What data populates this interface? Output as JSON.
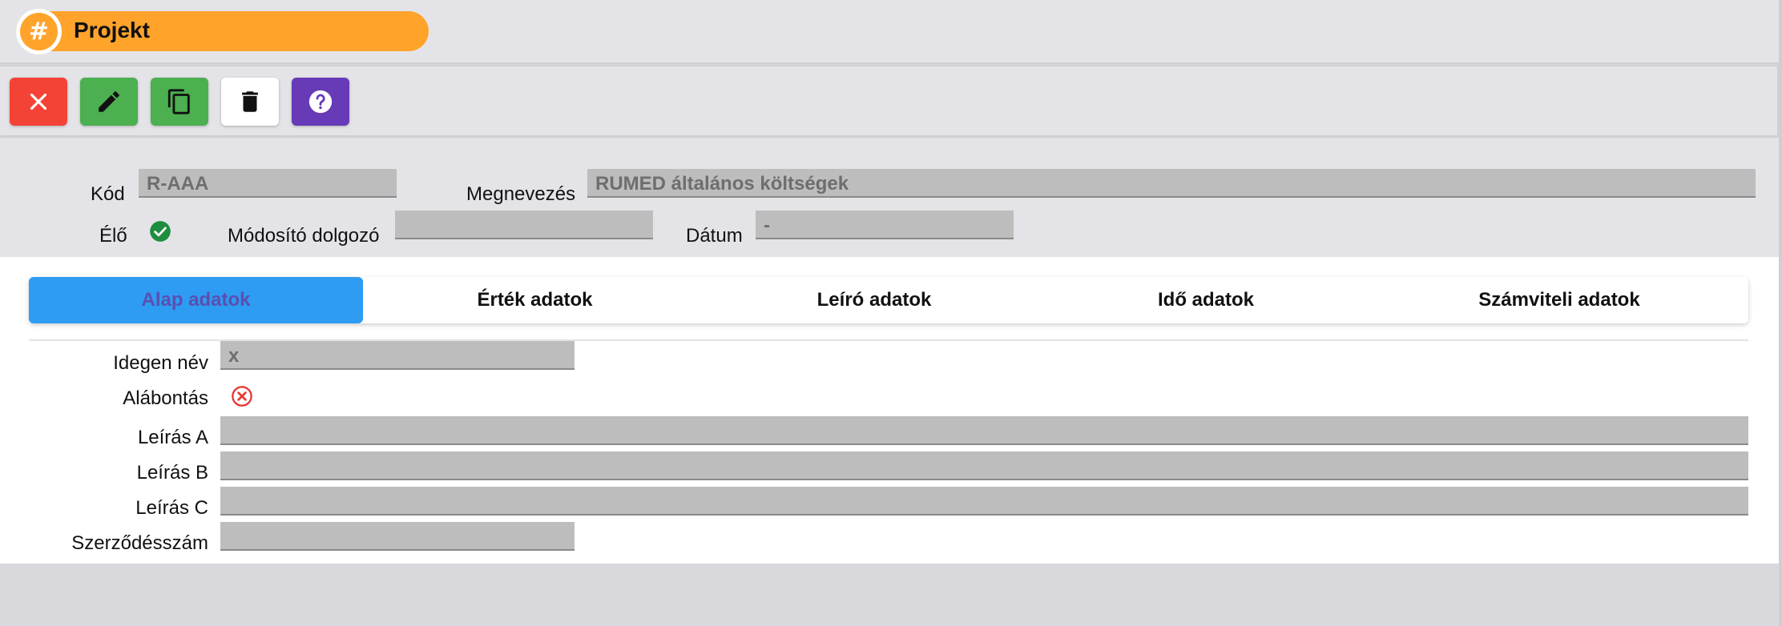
{
  "window": {
    "title": "Projekt",
    "title_icon": "hash-icon"
  },
  "toolbar": {
    "buttons": [
      {
        "name": "close",
        "icon": "close-icon",
        "color": "#f44336"
      },
      {
        "name": "edit",
        "icon": "pencil-icon",
        "color": "#4caf50"
      },
      {
        "name": "copy",
        "icon": "copy-icon",
        "color": "#4caf50"
      },
      {
        "name": "delete",
        "icon": "trash-icon",
        "color": "#ffffff"
      },
      {
        "name": "help",
        "icon": "help-icon",
        "color": "#673ab7"
      }
    ]
  },
  "header": {
    "kod_label": "Kód",
    "kod_value": "R-AAA",
    "megnevezes_label": "Megnevezés",
    "megnevezes_value": "RUMED általános költségek",
    "elo_label": "Élő",
    "elo_status": "check-icon",
    "modosito_label": "Módosító dolgozó",
    "modosito_value": "",
    "datum_label": "Dátum",
    "datum_value": "-"
  },
  "tabs": [
    {
      "label": "Alap adatok",
      "active": true
    },
    {
      "label": "Érték adatok",
      "active": false
    },
    {
      "label": "Leíró adatok",
      "active": false
    },
    {
      "label": "Idő adatok",
      "active": false
    },
    {
      "label": "Számviteli adatok",
      "active": false
    }
  ],
  "form": {
    "idegen_nev_label": "Idegen név",
    "idegen_nev_value": "x",
    "alabontas_label": "Alábontás",
    "alabontas_status": "x-circle-icon",
    "leiras_a_label": "Leírás A",
    "leiras_a_value": "",
    "leiras_b_label": "Leírás B",
    "leiras_b_value": "",
    "leiras_c_label": "Leírás C",
    "leiras_c_value": "",
    "szerzodesszam_label": "Szerződésszám",
    "szerzodesszam_value": ""
  },
  "colors": {
    "accent": "#ffa32b",
    "tab_active": "#2e9cf2",
    "success": "#1e8e3e",
    "error": "#e53935"
  }
}
